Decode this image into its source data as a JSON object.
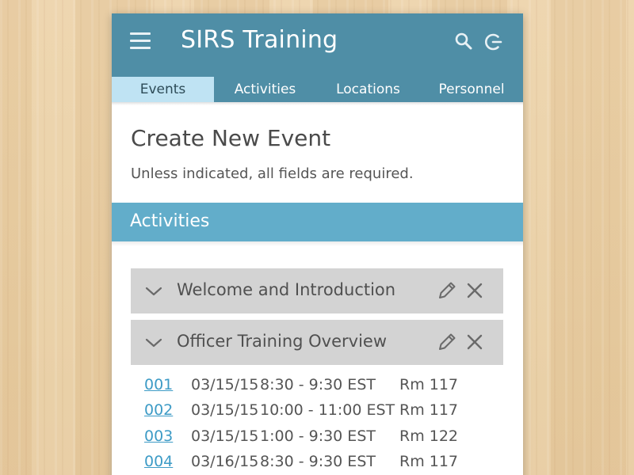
{
  "app": {
    "title": "SIRS Training"
  },
  "header_icons": {
    "menu": "hamburger-menu-icon",
    "search": "search-icon",
    "power": "power-icon"
  },
  "tabs": [
    {
      "label": "Events",
      "active": true
    },
    {
      "label": "Activities",
      "active": false
    },
    {
      "label": "Locations",
      "active": false
    },
    {
      "label": "Personnel",
      "active": false
    }
  ],
  "page": {
    "title": "Create New Event",
    "subtitle": "Unless indicated, all fields are required."
  },
  "section": {
    "label": "Activities"
  },
  "activities": [
    {
      "label": "Welcome and Introduction"
    },
    {
      "label": "Officer Training Overview"
    }
  ],
  "sessions": [
    {
      "id": "001",
      "date": "03/15/15",
      "time": "8:30 - 9:30 EST",
      "room": "Rm 117"
    },
    {
      "id": "002",
      "date": "03/15/15",
      "time": "10:00 - 11:00 EST",
      "room": "Rm 117"
    },
    {
      "id": "003",
      "date": "03/15/15",
      "time": "1:00 - 9:30 EST",
      "room": "Rm 122"
    },
    {
      "id": "004",
      "date": "03/16/15",
      "time": "8:30 - 9:30 EST",
      "room": "Rm 117"
    }
  ],
  "colors": {
    "app_bar": "#4f8ea6",
    "active_tab": "#bfe3f3",
    "section_header": "#62adca",
    "activity_row": "#d3d3d3",
    "link": "#3d9bc6"
  }
}
